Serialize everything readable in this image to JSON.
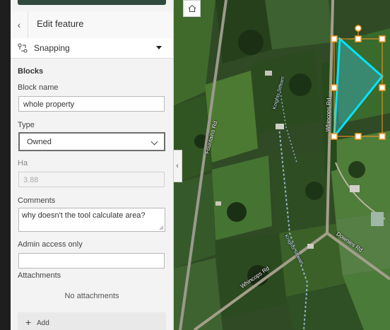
{
  "panel": {
    "title": "Edit feature",
    "snapping_label": "Snapping",
    "group_heading": "Blocks",
    "block_name": {
      "label": "Block name",
      "value": "whole property"
    },
    "type": {
      "label": "Type",
      "value": "Owned"
    },
    "ha": {
      "label": "Ha",
      "value": "3.88"
    },
    "comments": {
      "label": "Comments",
      "value": "why doesn't the tool calculate area?"
    },
    "admin": {
      "label": "Admin access only",
      "value": ""
    },
    "attachments": {
      "label": "Attachments",
      "empty": "No attachments",
      "add_label": "Add"
    }
  },
  "map": {
    "road_labels": [
      "Fountains Rd",
      "Whincops Rd",
      "Downies Rd",
      "Whincops Rd",
      "Knights Stream",
      "Knights Stream"
    ]
  },
  "colors": {
    "polygon_outline": "#00e5ff",
    "selection_handles": "#ff9a1f",
    "top_bar": "#2f4a3c"
  },
  "icons": [
    "chevron-left-icon",
    "snapping-icon",
    "caret-down-icon",
    "chevron-down-icon",
    "plus-icon",
    "home-icon",
    "collapse-icon",
    "rotate-handle-icon"
  ]
}
